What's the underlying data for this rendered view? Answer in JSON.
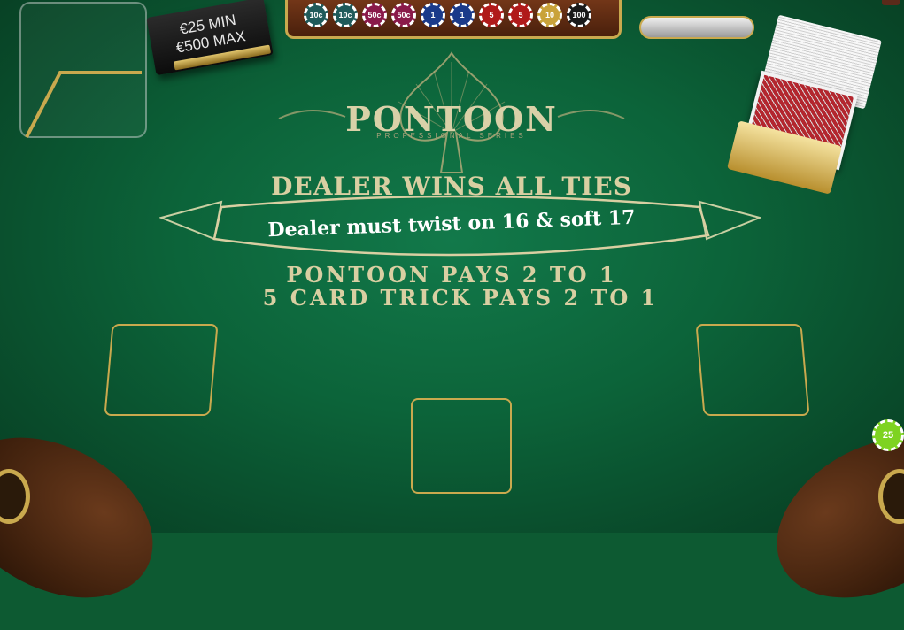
{
  "limits": {
    "min": "€25 MIN",
    "max": "€500 MAX"
  },
  "logo": {
    "title": "PONTOON",
    "subtitle": "PROFESSIONAL SERIES"
  },
  "rules": {
    "ties": "DEALER WINS ALL TIES",
    "dealer_rule": "Dealer must twist on 16 & soft 17",
    "pontoon_pays": "PONTOON PAYS 2 TO 1",
    "five_card_pays": "5 CARD TRICK PAYS 2 TO 1"
  },
  "chip_tray": [
    {
      "label": "10c",
      "color": "#1f5a5a"
    },
    {
      "label": "10c",
      "color": "#1f5a5a"
    },
    {
      "label": "50c",
      "color": "#8a1a4a"
    },
    {
      "label": "50c",
      "color": "#8a1a4a"
    },
    {
      "label": "1",
      "color": "#1a3a8a"
    },
    {
      "label": "1",
      "color": "#1a3a8a"
    },
    {
      "label": "5",
      "color": "#b01a1a"
    },
    {
      "label": "5",
      "color": "#b01a1a"
    },
    {
      "label": "10",
      "color": "#c9a23a"
    },
    {
      "label": "100",
      "color": "#1a1a1a"
    }
  ],
  "selected_chip": {
    "label": "25",
    "color": "#7ed321"
  },
  "colors": {
    "felt": "#0c6339",
    "gold": "#c9a94e",
    "text_gold": "#d9cfa2"
  }
}
